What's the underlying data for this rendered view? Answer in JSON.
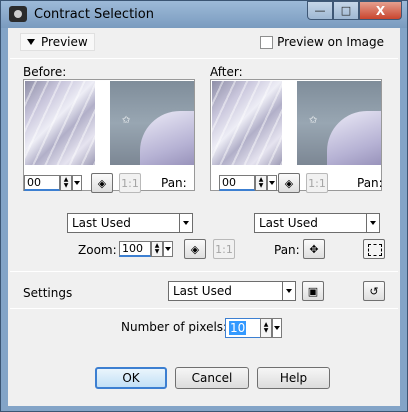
{
  "window": {
    "title": "Contract Selection",
    "controls": {
      "minimize": "—",
      "maximize": "□",
      "close": "X"
    }
  },
  "preview": {
    "toggle_label": "Preview",
    "preview_on_image_label": "Preview on Image",
    "preview_on_image_checked": false
  },
  "before": {
    "label": "Before:",
    "zoom_value": "00",
    "pan_label": "Pan:",
    "preset": "Last Used"
  },
  "after": {
    "label": "After:",
    "zoom_value": "00",
    "pan_label": "Pan:",
    "preset": "Last Used"
  },
  "zoom": {
    "label": "Zoom:",
    "value": "100",
    "pan_label": "Pan:"
  },
  "settings": {
    "label": "Settings",
    "preset": "Last Used"
  },
  "pixels": {
    "label": "Number of pixels:",
    "value": "10"
  },
  "buttons": {
    "ok": "OK",
    "cancel": "Cancel",
    "help": "Help"
  },
  "icons": {
    "zoom_fit": "crosshair-fit-icon",
    "zoom_actual": "actual-size-icon",
    "pan": "move-arrows-icon",
    "marquee": "dashed-selection-icon",
    "save_preset": "floppy-disk-icon",
    "reset": "reset-icon"
  }
}
